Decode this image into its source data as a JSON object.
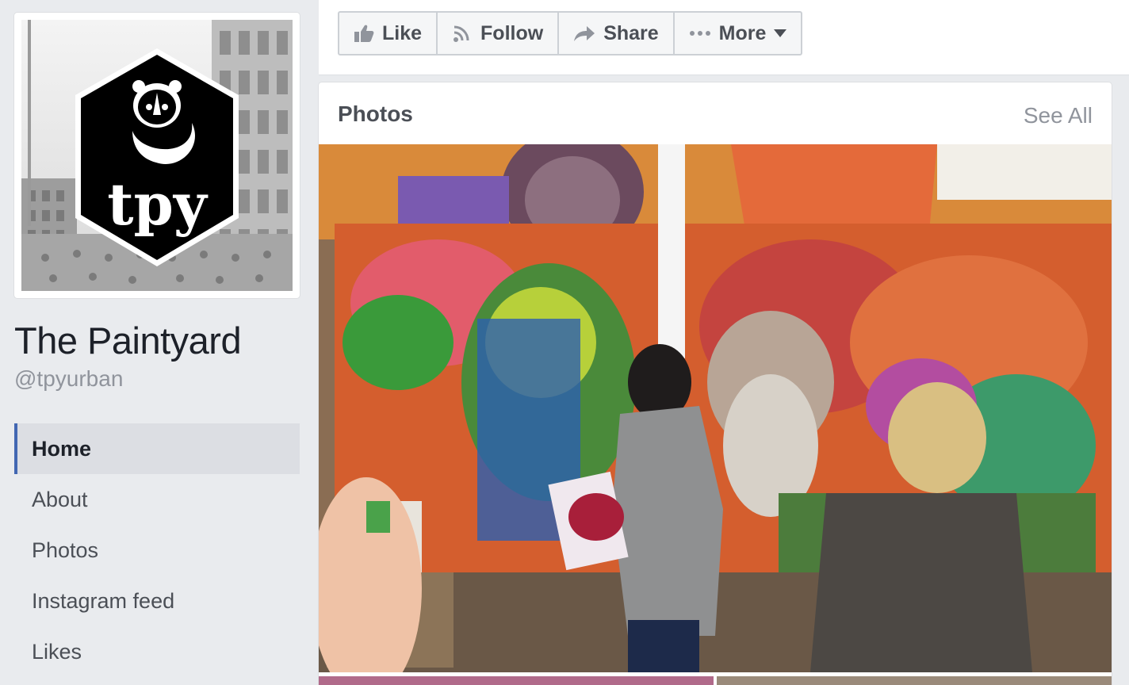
{
  "page": {
    "name": "The Paintyard",
    "handle": "@tpyurban",
    "logo_text": "tpy"
  },
  "nav": {
    "items": [
      {
        "label": "Home",
        "active": true
      },
      {
        "label": "About"
      },
      {
        "label": "Photos"
      },
      {
        "label": "Instagram feed"
      },
      {
        "label": "Likes"
      }
    ]
  },
  "actions": {
    "like": "Like",
    "follow": "Follow",
    "share": "Share",
    "more": "More"
  },
  "photos": {
    "title": "Photos",
    "see_all": "See All"
  },
  "colors": {
    "accent": "#4267b2",
    "page_bg": "#e9ebee",
    "muted_text": "#90949c"
  }
}
